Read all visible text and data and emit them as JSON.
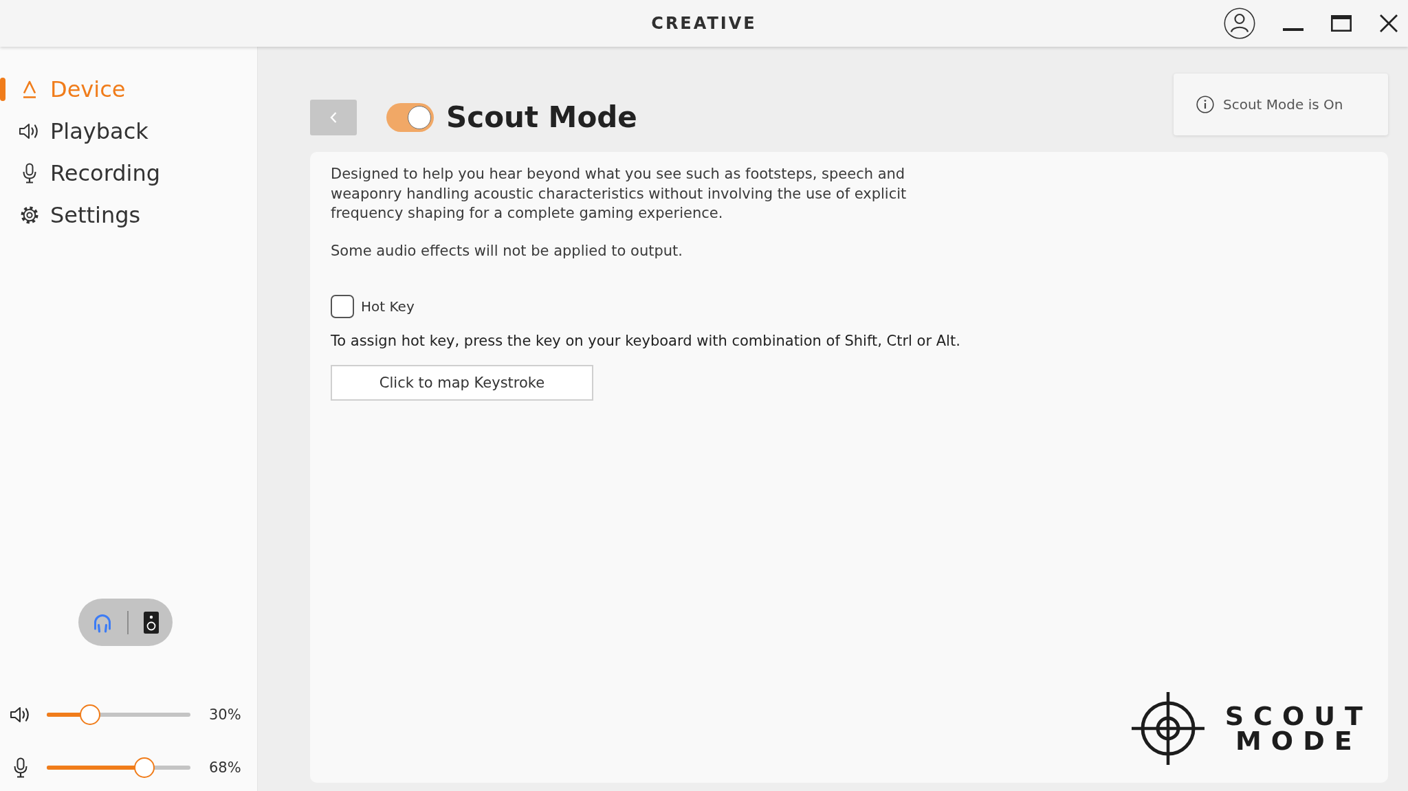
{
  "title_bar": {
    "logo": "CREATIVE"
  },
  "sidebar": {
    "items": [
      {
        "label": "Device",
        "selected": true
      },
      {
        "label": "Playback",
        "selected": false
      },
      {
        "label": "Recording",
        "selected": false
      },
      {
        "label": "Settings",
        "selected": false
      }
    ],
    "output_devices": [
      {
        "kind": "headphones",
        "selected": true
      },
      {
        "kind": "speaker",
        "selected": false
      }
    ],
    "sliders": [
      {
        "kind": "volume",
        "level": 0.3,
        "reading": "30%"
      },
      {
        "kind": "microphone",
        "level": 0.68,
        "reading": "68%"
      }
    ]
  },
  "header": {
    "title": "Scout Mode",
    "toggle": {
      "on": true
    },
    "status": "Scout Mode is On"
  },
  "content": {
    "description": "Designed to help you hear beyond what you see such as footsteps, speech and weaponry handling acoustic characteristics without involving the use of explicit frequency shaping for a complete gaming experience.",
    "note": "Some audio effects will not be applied to output.",
    "hot_key": {
      "label": "Hot Key",
      "checked": false
    },
    "instructions": "To assign hot key, press the key on your keyboard with combination of Shift, Ctrl or Alt.",
    "map_button": "Click to map Keystroke",
    "logo": {
      "line_1": "SCOUT",
      "line_2": "MODE"
    }
  }
}
